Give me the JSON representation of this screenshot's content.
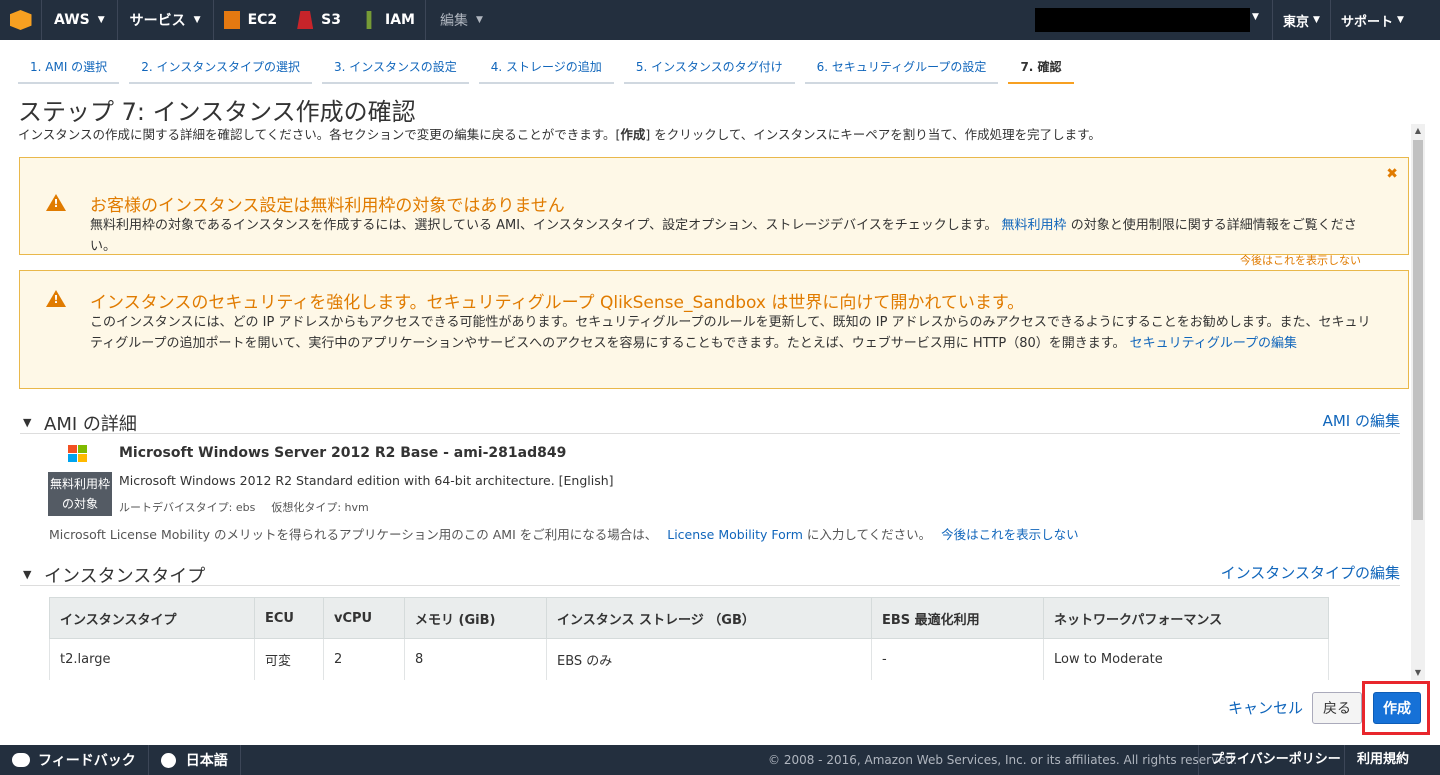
{
  "nav": {
    "aws": "AWS",
    "services": "サービス",
    "ec2": "EC2",
    "s3": "S3",
    "iam": "IAM",
    "edit": "編集",
    "region": "東京",
    "support": "サポート"
  },
  "tabs": [
    {
      "label": "1. AMI の選択"
    },
    {
      "label": "2. インスタンスタイプの選択"
    },
    {
      "label": "3. インスタンスの設定"
    },
    {
      "label": "4. ストレージの追加"
    },
    {
      "label": "5. インスタンスのタグ付け"
    },
    {
      "label": "6. セキュリティグループの設定"
    },
    {
      "label": "7. 確認"
    }
  ],
  "page": {
    "title": "ステップ 7: インスタンス作成の確認",
    "desc_pre": "インスタンスの作成に関する詳細を確認してください。各セクションで変更の編集に戻ることができます。[",
    "desc_bold": "作成",
    "desc_post": "] をクリックして、インスタンスにキーペアを割り当て、作成処理を完了します。"
  },
  "alert1": {
    "title": "お客様のインスタンス設定は無料利用枠の対象ではありません",
    "body_pre": "無料利用枠の対象であるインスタンスを作成するには、選択している AMI、インスタンスタイプ、設定オプション、ストレージデバイスをチェックします。",
    "link": "無料利用枠",
    "body_post": " の対象と使用制限に関する詳細情報をご覧ください。",
    "dismiss": "今後はこれを表示しない"
  },
  "alert2": {
    "title": "インスタンスのセキュリティを強化します。セキュリティグループ QlikSense_Sandbox は世界に向けて開かれています。",
    "body": "このインスタンスには、どの IP アドレスからもアクセスできる可能性があります。セキュリティグループのルールを更新して、既知の IP アドレスからのみアクセスできるようにすることをお勧めします。また、セキュリティグループの追加ポートを開いて、実行中のアプリケーションやサービスへのアクセスを容易にすることもできます。たとえば、ウェブサービス用に HTTP（80）を開きます。",
    "link": "セキュリティグループの編集"
  },
  "ami": {
    "section_title": "AMI の詳細",
    "edit": "AMI の編集",
    "free_tier_line1": "無料利用枠",
    "free_tier_line2": "の対象",
    "name": "Microsoft Windows Server 2012 R2 Base - ami-281ad849",
    "desc": "Microsoft Windows 2012 R2 Standard edition with 64-bit architecture. [English]",
    "root_device": "ルートデバイスタイプ: ebs",
    "virt_type": "仮想化タイプ: hvm",
    "note": "Microsoft License Mobility のメリットを得られるアプリケーション用のこの AMI をご利用になる場合は、",
    "note_link": "License Mobility Form",
    "note_post": "に入力してください。",
    "note_dismiss": "今後はこれを表示しない"
  },
  "itype": {
    "section_title": "インスタンスタイプ",
    "edit": "インスタンスタイプの編集",
    "headers": [
      "インスタンスタイプ",
      "ECU",
      "vCPU",
      "メモリ (GiB)",
      "インスタンス ストレージ （GB）",
      "EBS 最適化利用",
      "ネットワークパフォーマンス"
    ],
    "row": [
      "t2.large",
      "可変",
      "2",
      "8",
      "EBS のみ",
      "-",
      "Low to Moderate"
    ]
  },
  "actions": {
    "cancel": "キャンセル",
    "back": "戻る",
    "create": "作成"
  },
  "footer": {
    "feedback": "フィードバック",
    "language": "日本語",
    "copyright": "© 2008 - 2016, Amazon Web Services, Inc. or its affiliates. All rights reserved.",
    "privacy": "プライバシーポリシー",
    "terms": "利用規約"
  },
  "colors": {
    "nav_bg": "#232f3e",
    "link": "#1166bb",
    "warning": "#e07b00",
    "primary": "#1671d7"
  }
}
